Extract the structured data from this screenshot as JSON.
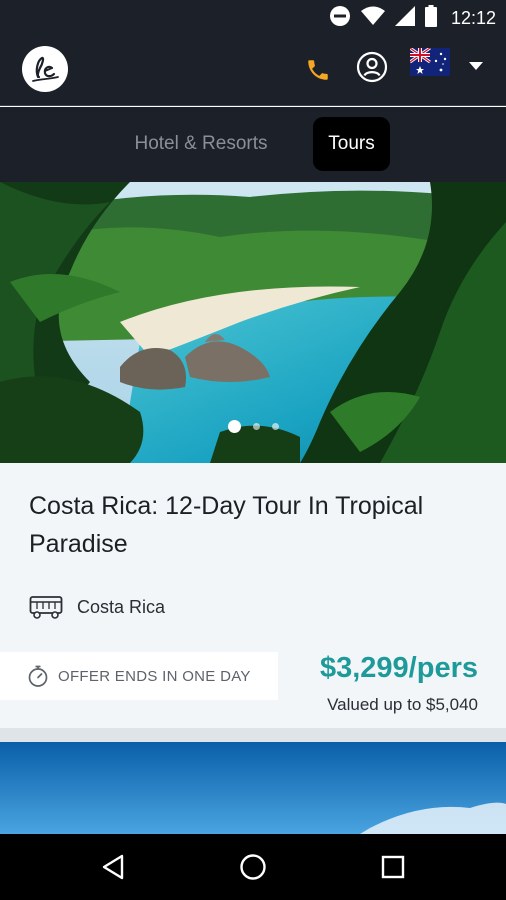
{
  "status_bar": {
    "time": "12:12",
    "icons": [
      "do-not-disturb-icon",
      "wifi-icon",
      "signal-icon",
      "battery-icon"
    ]
  },
  "header": {
    "logo_text": "le",
    "icons": [
      "phone-icon",
      "account-icon",
      "australia-flag-icon",
      "caret-down-icon"
    ],
    "accent_color": "#f5a623"
  },
  "tabs": [
    {
      "label": "Hotel & Resorts",
      "active": false
    },
    {
      "label": "Tours",
      "active": true
    }
  ],
  "carousel": {
    "slide_count": 3,
    "active_index": 0
  },
  "deal": {
    "title": "Costa Rica: 12-Day Tour In Tropical Paradise",
    "location_icon": "bus-icon",
    "location": "Costa Rica",
    "offer_icon": "stopwatch-icon",
    "offer_text": "OFFER ENDS IN ONE DAY",
    "price": "$3,299/pers",
    "valued": "Valued up to $5,040",
    "price_color": "#1e9a9b"
  },
  "nav_bar": {
    "icons": [
      "back-icon",
      "home-icon",
      "recents-icon"
    ]
  }
}
